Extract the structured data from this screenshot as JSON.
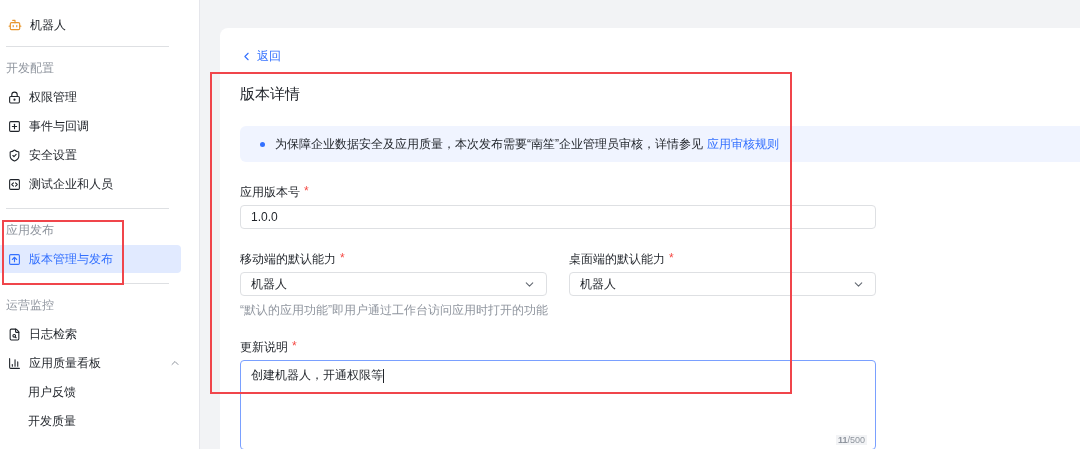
{
  "sidebar": {
    "app_title": "机器人",
    "sections": [
      {
        "label": "开发配置",
        "items": [
          {
            "label": "权限管理",
            "selected": false
          },
          {
            "label": "事件与回调",
            "selected": false
          },
          {
            "label": "安全设置",
            "selected": false
          },
          {
            "label": "测试企业和人员",
            "selected": false
          }
        ]
      },
      {
        "label": "应用发布",
        "items": [
          {
            "label": "版本管理与发布",
            "selected": true
          }
        ]
      },
      {
        "label": "运营监控",
        "items": [
          {
            "label": "日志检索",
            "selected": false
          },
          {
            "label": "应用质量看板",
            "selected": false,
            "expanded": true,
            "children": [
              {
                "label": "用户反馈",
                "selected": false
              },
              {
                "label": "开发质量",
                "selected": false
              }
            ]
          }
        ]
      }
    ]
  },
  "back_link": "返回",
  "title": "版本详情",
  "notice": {
    "text": "为保障企业数据安全及应用质量，本次发布需要“南笙”企业管理员审核，详情参见",
    "link": "应用审核规则"
  },
  "form": {
    "version": {
      "label": "应用版本号",
      "required_mark": "*",
      "value": "1.0.0"
    },
    "mobile_default": {
      "label": "移动端的默认能力",
      "required_mark": "*",
      "value": "机器人"
    },
    "desktop_default": {
      "label": "桌面端的默认能力",
      "required_mark": "*",
      "value": "机器人"
    },
    "default_hint": "“默认的应用功能”即用户通过工作台访问应用时打开的功能",
    "description": {
      "label": "更新说明",
      "required_mark": "*",
      "value": "创建机器人，开通权限等",
      "counter": "**11**/500"
    }
  }
}
